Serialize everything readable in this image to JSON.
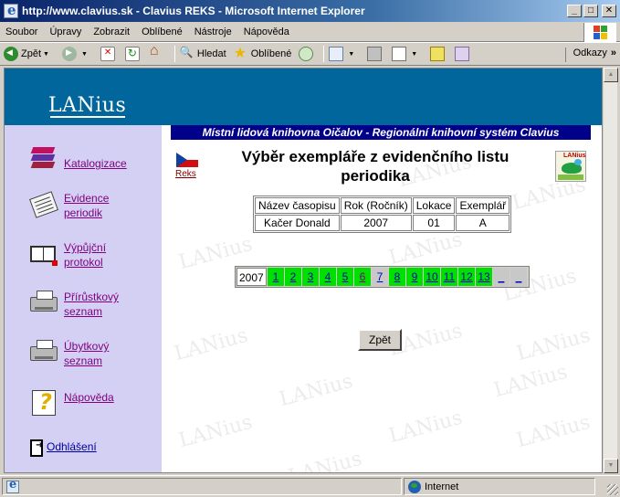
{
  "window": {
    "title": "http://www.clavius.sk - Clavius REKS - Microsoft Internet Explorer",
    "minimize": "_",
    "maximize": "□",
    "close": "✕"
  },
  "menu": {
    "items": [
      "Soubor",
      "Úpravy",
      "Zobrazit",
      "Oblíbené",
      "Nástroje",
      "Nápověda"
    ]
  },
  "toolbar": {
    "back_label": "Zpět",
    "search_label": "Hledat",
    "favorites_label": "Oblíbené",
    "links_label": "Odkazy",
    "links_chevron": "»"
  },
  "sidebar": {
    "logo": "LANius",
    "items": [
      {
        "label": "Katalogizace",
        "icon": "books-icon"
      },
      {
        "label": "Evidence periodik",
        "icon": "newspaper-icon"
      },
      {
        "label": "Výpůjční protokol",
        "icon": "open-book-icon"
      },
      {
        "label": "Přírůstkový seznam",
        "icon": "printer-icon"
      },
      {
        "label": "Úbytkový seznam",
        "icon": "printer-icon"
      },
      {
        "label": "Nápověda",
        "icon": "help-icon"
      }
    ],
    "logout_label": "Odhlášení"
  },
  "main": {
    "library_banner": "Místní lidová knihovna Oičalov - Regionální knihovní systém Clavius",
    "reks_link": "Reks",
    "heading": "Výběr exempláře z evidenčního listu periodika",
    "badge_text": "LANius",
    "watermark": "LANius",
    "table": {
      "headers": [
        "Název časopisu",
        "Rok (Ročník)",
        "Lokace",
        "Exemplář"
      ],
      "row": [
        "Kačer Donald",
        "2007",
        "01",
        "A"
      ]
    },
    "issues": {
      "year": "2007",
      "numbers": [
        "1",
        "2",
        "3",
        "4",
        "5",
        "6",
        "7",
        "8",
        "9",
        "10",
        "11",
        "12",
        "13",
        "_",
        "_"
      ],
      "visited": [
        "6",
        "7"
      ],
      "empty": [
        "7",
        "_"
      ]
    },
    "back_button": "Zpět"
  },
  "statusbar": {
    "zone": "Internet"
  },
  "colors": {
    "header_band": "#00669c",
    "sidebar_bg": "#d4d0f4",
    "banner_bg": "#00008b",
    "issue_green": "#00e000",
    "link_visited": "#800080"
  }
}
